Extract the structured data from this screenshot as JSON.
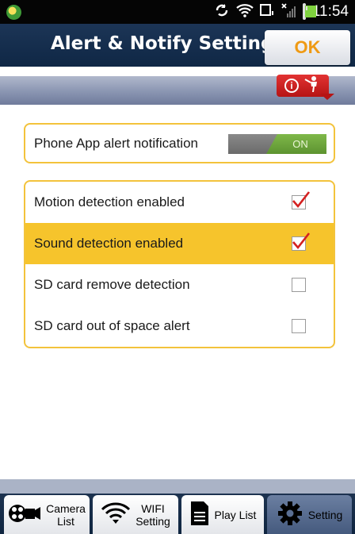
{
  "status_bar": {
    "time": "11:54",
    "icons": [
      "app-logo-icon",
      "sync-icon",
      "wifi-icon",
      "sd-card-icon",
      "no-signal-icon",
      "battery-icon"
    ]
  },
  "header": {
    "title": "Alert & Notify Setting",
    "ok_label": "OK"
  },
  "info_button": {
    "icons": [
      "info-icon",
      "person-icon"
    ]
  },
  "phone_alert": {
    "label": "Phone App alert notification",
    "toggle_state": "ON"
  },
  "options": [
    {
      "label": "Motion detection enabled",
      "checked": true,
      "highlighted": false
    },
    {
      "label": "Sound detection enabled",
      "checked": true,
      "highlighted": true
    },
    {
      "label": "SD card remove detection",
      "checked": false,
      "highlighted": false
    },
    {
      "label": "SD card out of space alert",
      "checked": false,
      "highlighted": false
    }
  ],
  "tabs": [
    {
      "label": "Camera List",
      "line1": "Camera",
      "line2": "List",
      "icon": "camera-icon",
      "active": false
    },
    {
      "label": "WIFI Setting",
      "line1": "WIFI",
      "line2": "Setting",
      "icon": "wifi-icon",
      "active": false
    },
    {
      "label": "Play List",
      "line1": "Play List",
      "line2": "",
      "icon": "file-icon",
      "active": false
    },
    {
      "label": "Setting",
      "line1": "Setting",
      "line2": "",
      "icon": "gear-icon",
      "active": true
    }
  ],
  "colors": {
    "accent": "#f6c42c",
    "title_bar": "#1c3556",
    "ok_text": "#ef9a14",
    "toggle_on": "#6fa63c",
    "check": "#d42020"
  }
}
